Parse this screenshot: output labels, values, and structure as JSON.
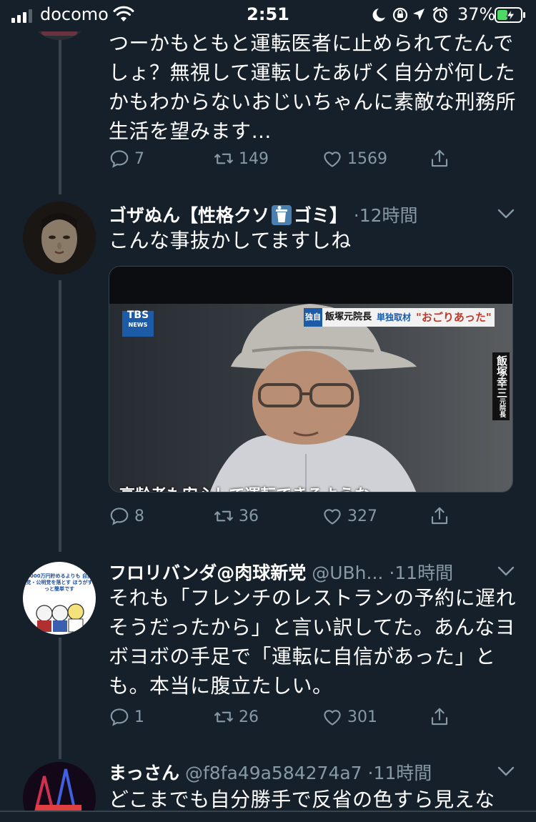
{
  "status_bar": {
    "carrier": "docomo",
    "time": "2:51",
    "battery": "37%"
  },
  "tweets": [
    {
      "text_lines": [
        "つーかもともと運転医者に止められてたんで",
        "しょ？無視して運転したあげく自分が何した",
        "かもわからないおじいちゃんに素敵な刑務所",
        "生活を望みます…"
      ],
      "replies": "7",
      "retweets": "149",
      "likes": "1569"
    },
    {
      "name": "ゴザぬん【性格クソ",
      "name_suffix": "ゴミ】",
      "time": "·12時間",
      "text_lines": [
        "こんな事抜かしてますしね"
      ],
      "media": {
        "logo": "TBS",
        "logo_sub": "NEWS",
        "banner_tag": "独自",
        "banner_name": "飯塚元院長",
        "banner_label": "単独取材",
        "banner_quote": "\"おごりあった\"",
        "side_caption": "飯塚幸三",
        "side_caption_small": "元院長",
        "subtitle": "高齢者も安心して運転できるような"
      },
      "replies": "8",
      "retweets": "36",
      "likes": "327"
    },
    {
      "name": "フロリバンダ@肉球新党",
      "handle": "@UBh...",
      "time": "·11時間",
      "avatar_text": "2000万円貯めるよりも 自民党・公明党を落とす ほうがずっと簡単です",
      "text_lines": [
        "それも「フレンチのレストランの予約に遅れ",
        "そうだったから」と言い訳してた。あんなヨ",
        "ボヨボの手足で「運転に自信があった」と",
        "も。本当に腹立たしい。"
      ],
      "replies": "1",
      "retweets": "26",
      "likes": "301"
    },
    {
      "name": "まっさん",
      "handle": "@f8fa49a584274a7",
      "time": "·11時間",
      "text_lines": [
        "どこまでも自分勝手で反省の色すら見えな"
      ]
    }
  ],
  "colors": {
    "background": "#15202b",
    "secondary_text": "#8899a6",
    "thread_line": "#38444d",
    "battery_green": "#4cd964"
  },
  "icons": [
    "signal-icon",
    "wifi-icon",
    "moon-icon",
    "rotation-lock-icon",
    "location-icon",
    "alarm-icon",
    "battery-icon",
    "reply-icon",
    "retweet-icon",
    "like-icon",
    "share-icon",
    "chevron-down-icon",
    "trash-icon"
  ]
}
